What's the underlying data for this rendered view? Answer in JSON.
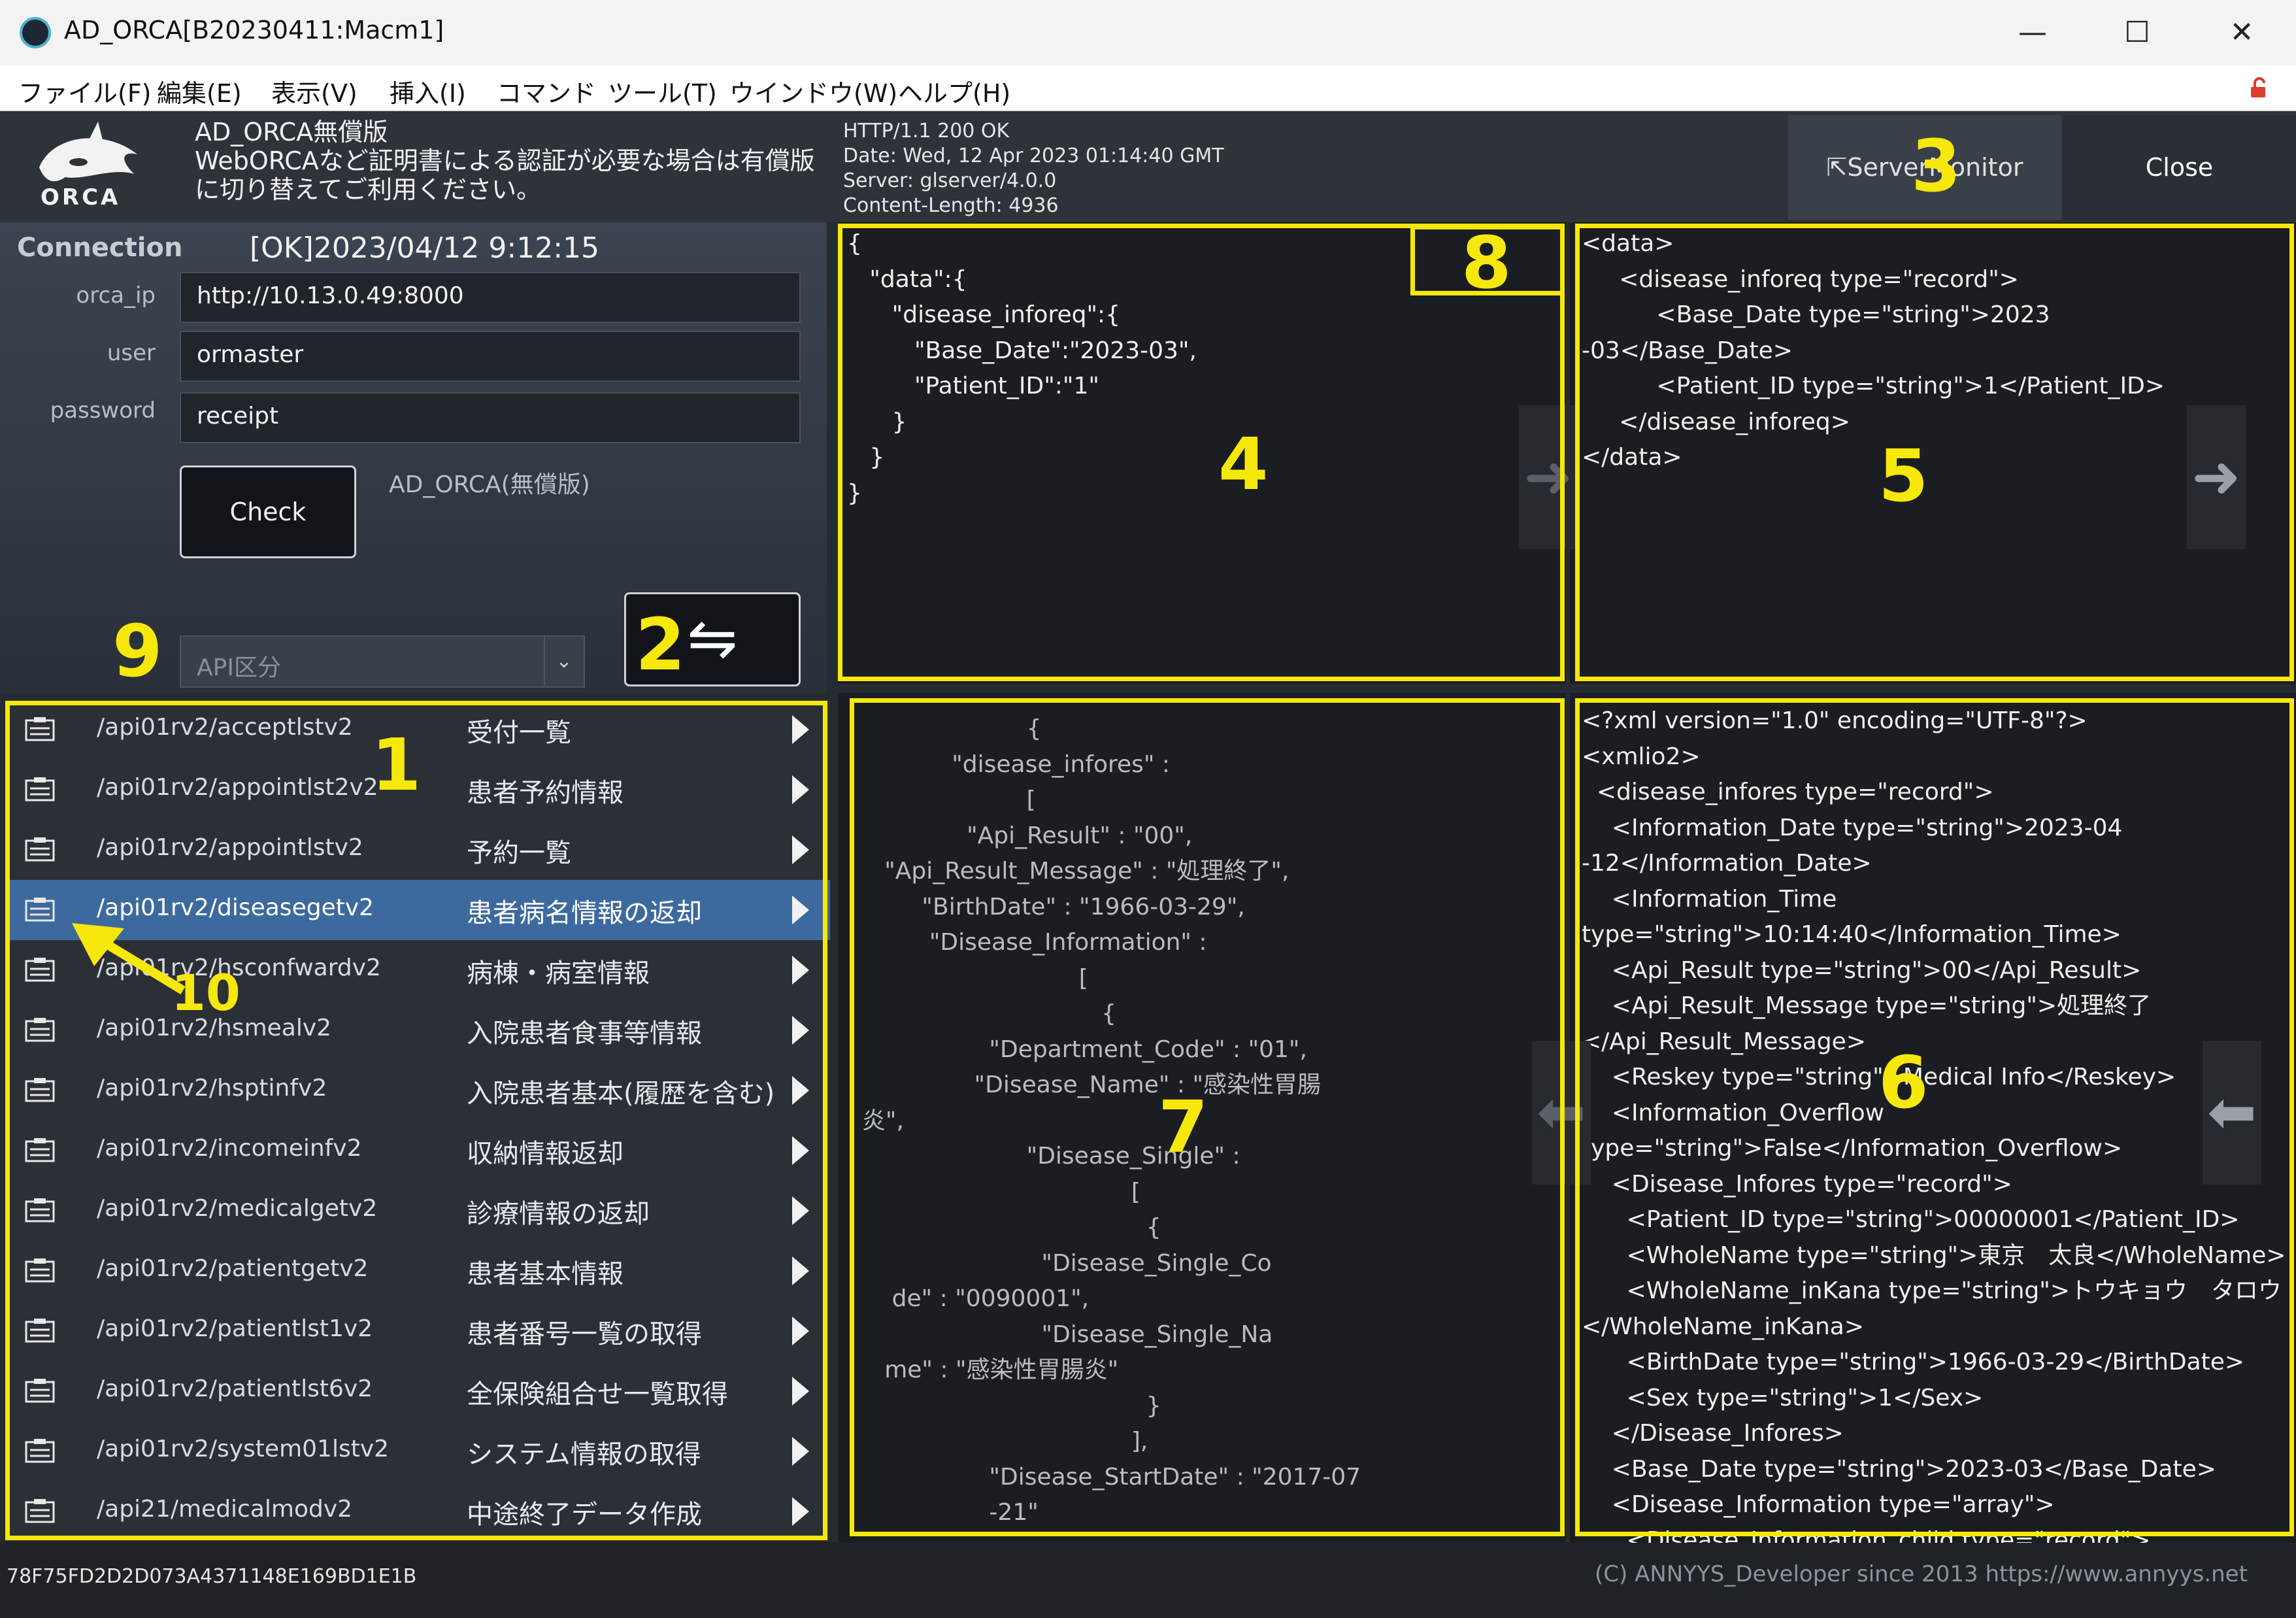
{
  "window": {
    "title": "AD_ORCA[B20230411:Macm1]",
    "minimize": "—",
    "maximize": "☐",
    "close": "✕"
  },
  "menu": [
    "ファイル(F)",
    "編集(E)",
    "表示(V)",
    "挿入(I)",
    "コマンド",
    "ツール(T)",
    "ウインドウ(W)",
    "ヘルプ(H)"
  ],
  "header": {
    "logo_text": "ORCA",
    "notice_line1": "AD_ORCA無償版",
    "notice_line2": "WebORCAなど証明書による認証が必要な場合は有償版に切り替えてご利用ください。",
    "http_response": "HTTP/1.1 200 OK\nDate: Wed, 12 Apr 2023 01:14:40 GMT\nServer: glserver/4.0.0\nContent-Length: 4936",
    "monitor_button": "⇱ServerMonitor",
    "close_button": "Close"
  },
  "connection": {
    "label": "Connection",
    "status": "[OK]2023/04/12 9:12:15",
    "orca_ip_label": "orca_ip",
    "orca_ip": "http://10.13.0.49:8000",
    "user_label": "user",
    "user": "ormaster",
    "password_label": "password",
    "password": "receipt",
    "check_button": "Check",
    "edition": "AD_ORCA(無償版)",
    "api_select_placeholder": "API区分",
    "swap_button": "⇋"
  },
  "api_list": [
    {
      "path": "/api01rv2/acceptlstv2",
      "desc": "受付一覧"
    },
    {
      "path": "/api01rv2/appointlst2v2",
      "desc": "患者予約情報"
    },
    {
      "path": "/api01rv2/appointlstv2",
      "desc": "予約一覧"
    },
    {
      "path": "/api01rv2/diseasegetv2",
      "desc": "患者病名情報の返却",
      "selected": true
    },
    {
      "path": "/api01rv2/hsconfwardv2",
      "desc": "病棟・病室情報"
    },
    {
      "path": "/api01rv2/hsmealv2",
      "desc": "入院患者食事等情報"
    },
    {
      "path": "/api01rv2/hsptinfv2",
      "desc": "入院患者基本(履歴を含む)"
    },
    {
      "path": "/api01rv2/incomeinfv2",
      "desc": "収納情報返却"
    },
    {
      "path": "/api01rv2/medicalgetv2",
      "desc": "診療情報の返却"
    },
    {
      "path": "/api01rv2/patientgetv2",
      "desc": "患者基本情報"
    },
    {
      "path": "/api01rv2/patientlst1v2",
      "desc": "患者番号一覧の取得"
    },
    {
      "path": "/api01rv2/patientlst6v2",
      "desc": "全保険組合せ一覧取得"
    },
    {
      "path": "/api01rv2/system01lstv2",
      "desc": "システム情報の取得"
    },
    {
      "path": "/api21/medicalmodv2",
      "desc": "中途終了データ作成"
    }
  ],
  "panes": {
    "request_json": "{\n   \"data\":{\n      \"disease_inforeq\":{\n         \"Base_Date\":\"2023-03\",\n         \"Patient_ID\":\"1\"\n      }\n   }\n}",
    "request_xml": "<data>\n     <disease_inforeq type=\"record\">\n          <Base_Date type=\"string\">2023\n-03</Base_Date>\n          <Patient_ID type=\"string\">1</Patient_ID>\n     </disease_inforeq>\n</data>",
    "response_json": "                        {\n              \"disease_infores\" :\n                        [\n                \"Api_Result\" : \"00\",\n     \"Api_Result_Message\" : \"処理終了\",\n          \"BirthDate\" : \"1966-03-29\",\n           \"Disease_Information\" :\n                               [\n                                  {\n                   \"Department_Code\" : \"01\",\n                 \"Disease_Name\" : \"感染性胃腸\n  炎\",\n                        \"Disease_Single\" :\n                                      [\n                                        {\n                          \"Disease_Single_Co\n      de\" : \"0090001\",\n                          \"Disease_Single_Na\n     me\" : \"感染性胃腸炎\"\n                                        }\n                                      ],\n                   \"Disease_StartDate\" : \"2017-07\n                   -21\"",
    "response_xml": "<?xml version=\"1.0\" encoding=\"UTF-8\"?>\n<xmlio2>\n  <disease_infores type=\"record\">\n    <Information_Date type=\"string\">2023-04\n-12</Information_Date>\n    <Information_Time\ntype=\"string\">10:14:40</Information_Time>\n    <Api_Result type=\"string\">00</Api_Result>\n    <Api_Result_Message type=\"string\">処理終了\n</Api_Result_Message>\n    <Reskey type=\"string\">Medical Info</Reskey>\n    <Information_Overflow\ntype=\"string\">False</Information_Overflow>\n    <Disease_Infores type=\"record\">\n      <Patient_ID type=\"string\">00000001</Patient_ID>\n      <WholeName type=\"string\">東京　太良</WholeName>\n      <WholeName_inKana type=\"string\">トウキョウ　タロウ\n</WholeName_inKana>\n      <BirthDate type=\"string\">1966-03-29</BirthDate>\n      <Sex type=\"string\">1</Sex>\n    </Disease_Infores>\n    <Base_Date type=\"string\">2023-03</Base_Date>\n    <Disease_Information type=\"array\">\n      <Disease_Information_child type=\"record\">"
  },
  "annotations": [
    "1",
    "2",
    "3",
    "4",
    "5",
    "6",
    "7",
    "8",
    "9",
    "10"
  ],
  "status": {
    "hash": "78F75FD2D2D073A4371148E169BD1E1B",
    "copyright": "(C) ANNYYS_Developer since 2013   https://www.annyys.net"
  },
  "colors": {
    "annotation": "#f6e80a",
    "selected_row": "#3d6a9e",
    "app_background": "#262b31"
  }
}
